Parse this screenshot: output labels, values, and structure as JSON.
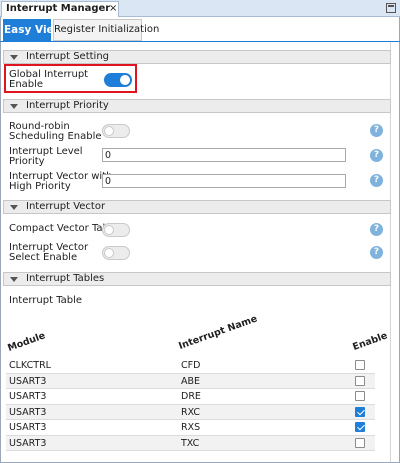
{
  "window": {
    "tab_title": "Interrupt Manager",
    "close_glyph": "×",
    "restore_icon": "restore-icon"
  },
  "view_tabs": [
    {
      "label": "Easy View",
      "active": true
    },
    {
      "label": "Register Initialization",
      "active": false
    }
  ],
  "sections": {
    "interrupt_setting": {
      "title": "Interrupt Setting",
      "global_interrupt": {
        "label": "Global Interrupt\nEnable",
        "enabled": true
      }
    },
    "interrupt_priority": {
      "title": "Interrupt Priority",
      "round_robin": {
        "label": "Round-robin\nScheduling Enable",
        "enabled": false
      },
      "level_priority": {
        "label": "Interrupt Level\nPriority",
        "value": "0"
      },
      "vector_high": {
        "label": "Interrupt Vector with\nHigh Priority",
        "value": "0"
      }
    },
    "interrupt_vector": {
      "title": "Interrupt Vector",
      "compact_table": {
        "label": "Compact Vector Table",
        "enabled": false
      },
      "vector_select": {
        "label": "Interrupt Vector\nSelect Enable",
        "enabled": false
      }
    },
    "interrupt_tables": {
      "title": "Interrupt Tables",
      "table_label": "Interrupt Table",
      "columns": {
        "module": "Module",
        "name": "Interrupt Name",
        "enable": "Enable"
      },
      "rows": [
        {
          "module": "CLKCTRL",
          "name": "CFD",
          "enabled": false
        },
        {
          "module": "USART3",
          "name": "ABE",
          "enabled": false
        },
        {
          "module": "USART3",
          "name": "DRE",
          "enabled": false
        },
        {
          "module": "USART3",
          "name": "RXC",
          "enabled": true
        },
        {
          "module": "USART3",
          "name": "RXS",
          "enabled": true
        },
        {
          "module": "USART3",
          "name": "TXC",
          "enabled": false
        }
      ]
    }
  },
  "help_glyph": "?",
  "colors": {
    "accent": "#1f7ed8",
    "highlight": "#e0141e"
  }
}
